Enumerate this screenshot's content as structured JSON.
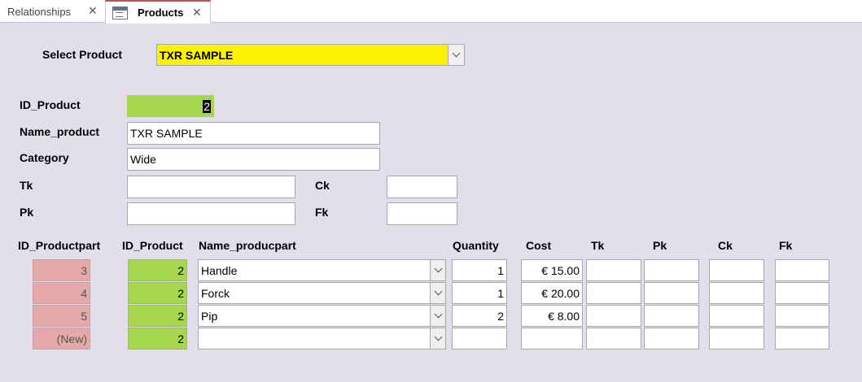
{
  "tabs": [
    {
      "label": "Relationships"
    },
    {
      "label": "Products"
    }
  ],
  "icons": {
    "close": "close-icon",
    "form": "form-icon",
    "dropdown": "chevron-down-icon"
  },
  "colors": {
    "background": "#e2dfeb",
    "id_product": "#a6d74f",
    "id_productpart": "#e4a9a8",
    "selector": "#fff200",
    "active_tab_accent": "#c0504d"
  },
  "header": {
    "select_label": "Select Product",
    "select_value": "TXR SAMPLE"
  },
  "form": {
    "id_product_label": "ID_Product",
    "id_product_value": "2",
    "name_label": "Name_product",
    "name_value": "TXR SAMPLE",
    "category_label": "Category",
    "category_value": "Wide",
    "tk_label": "Tk",
    "tk_value": "",
    "ck_label": "Ck",
    "ck_value": "",
    "pk_label": "Pk",
    "pk_value": "",
    "fk_label": "Fk",
    "fk_value": ""
  },
  "subform": {
    "columns": [
      "ID_Productpart",
      "ID_Product",
      "Name_producpart",
      "Quantity",
      "Cost",
      "Tk",
      "Pk",
      "Ck",
      "Fk"
    ],
    "rows": [
      {
        "id_part": "3",
        "id_product": "2",
        "name": "Handle",
        "quantity": "1",
        "cost": "€ 15.00",
        "tk": "",
        "pk": "",
        "ck": "",
        "fk": ""
      },
      {
        "id_part": "4",
        "id_product": "2",
        "name": "Forck",
        "quantity": "1",
        "cost": "€ 20.00",
        "tk": "",
        "pk": "",
        "ck": "",
        "fk": ""
      },
      {
        "id_part": "5",
        "id_product": "2",
        "name": "Pip",
        "quantity": "2",
        "cost": "€ 8.00",
        "tk": "",
        "pk": "",
        "ck": "",
        "fk": ""
      },
      {
        "id_part": "(New)",
        "id_product": "2",
        "name": "",
        "quantity": "",
        "cost": "",
        "tk": "",
        "pk": "",
        "ck": "",
        "fk": ""
      }
    ]
  }
}
